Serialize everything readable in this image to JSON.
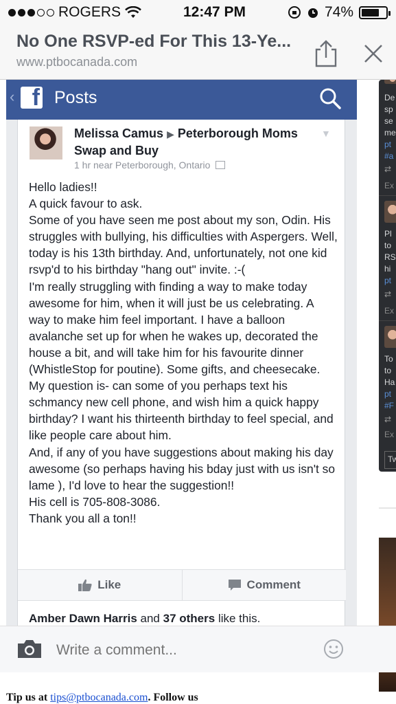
{
  "status_bar": {
    "carrier": "ROGERS",
    "time": "12:47 PM",
    "battery": "74%",
    "battery_level": 0.74
  },
  "browser": {
    "title": "No One RSVP-ed For This 13-Ye...",
    "url": "www.ptbocanada.com"
  },
  "fb": {
    "header_title": "Posts",
    "post": {
      "author": "Melissa Camus",
      "target_group": "Peterborough Moms Swap and Buy",
      "meta": "1 hr near Peterborough, Ontario",
      "body": [
        "Hello ladies!!",
        "A quick favour to ask.",
        "Some of you have seen me post about my son, Odin. His struggles with bullying, his difficulties with Aspergers. Well, today is his 13th birthday. And, unfortunately, not one kid rsvp'd to his birthday \"hang out\" invite. :-(",
        "I'm really struggling with finding a way to make today awesome for him, when it will just be us celebrating. A way to make him feel important. I have a balloon avalanche set up for when he wakes up, decorated the house a bit, and will take him for his favourite dinner (WhistleStop for poutine). Some gifts, and cheesecake.",
        "My question is- can some of you perhaps text his schmancy new cell phone, and wish him a quick happy birthday? I want his thirteenth birthday to feel special, and like people care about him.",
        "And, if any of you have suggestions about making his day awesome (so perhaps having his bday just with us isn't so lame ), I'd love to hear the suggestion!!",
        "His cell is 705-808-3086.",
        "Thank you all a ton!!"
      ],
      "like_label": "Like",
      "comment_label": "Comment",
      "likes_name": "Amber Dawn Harris",
      "likes_and": "and",
      "likes_others": "37 others",
      "likes_suffix": "like this."
    }
  },
  "sidebar": {
    "items": [
      {
        "text": "De"
      },
      {
        "text": "sp"
      },
      {
        "text": "se"
      },
      {
        "text": "me"
      },
      {
        "text": "pt"
      },
      {
        "text": "#a"
      },
      {
        "text": "Ex"
      },
      {
        "text": "Pl"
      },
      {
        "text": "to"
      },
      {
        "text": "RS"
      },
      {
        "text": "hi"
      },
      {
        "text": "pt"
      },
      {
        "text": "Ex"
      },
      {
        "text": "To"
      },
      {
        "text": "to"
      },
      {
        "text": "Ha"
      },
      {
        "text": "pt"
      },
      {
        "text": "#F"
      },
      {
        "text": "Ex"
      }
    ],
    "box": "Tw"
  },
  "comment_bar": {
    "placeholder": "Write a comment..."
  },
  "footer": {
    "prefix": "Tip us at",
    "email": "tips@ptbocanada.com",
    "suffix": ". Follow us"
  }
}
